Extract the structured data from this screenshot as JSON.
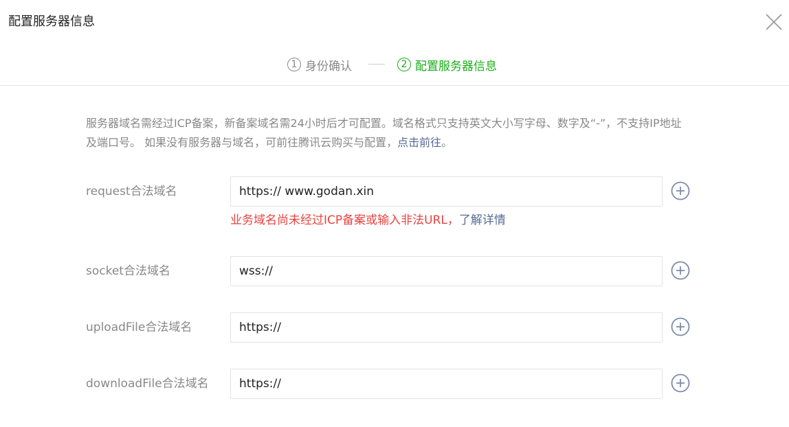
{
  "dialog": {
    "title": "配置服务器信息"
  },
  "steps": [
    {
      "number": "1",
      "label": "身份确认",
      "state": "done"
    },
    {
      "number": "2",
      "label": "配置服务器信息",
      "state": "active"
    }
  ],
  "notice": {
    "text": "服务器域名需经过ICP备案，新备案域名需24小时后才可配置。域名格式只支持英文大小写字母、数字及“-”，不支持IP地址及端口号。 如果没有服务器与域名，可前往腾讯云购买与配置，",
    "link": "点击前往",
    "suffix": "。"
  },
  "fields": {
    "request": {
      "label": "request合法域名",
      "value": "https:// www.godan.xin",
      "error": "业务域名尚未经过ICP备案或输入非法URL，",
      "error_link": "了解详情"
    },
    "socket": {
      "label": "socket合法域名",
      "value": "wss://"
    },
    "upload": {
      "label": "uploadFile合法域名",
      "value": "https://"
    },
    "download": {
      "label": "downloadFile合法域名",
      "value": "https://"
    }
  },
  "icons": {
    "close": "close-icon",
    "add": "plus-circle-icon"
  },
  "colors": {
    "active_step": "#1aad19",
    "error": "#e64340",
    "link": "#576b95",
    "muted_text": "#888888",
    "add_icon": "#7d8aab"
  }
}
